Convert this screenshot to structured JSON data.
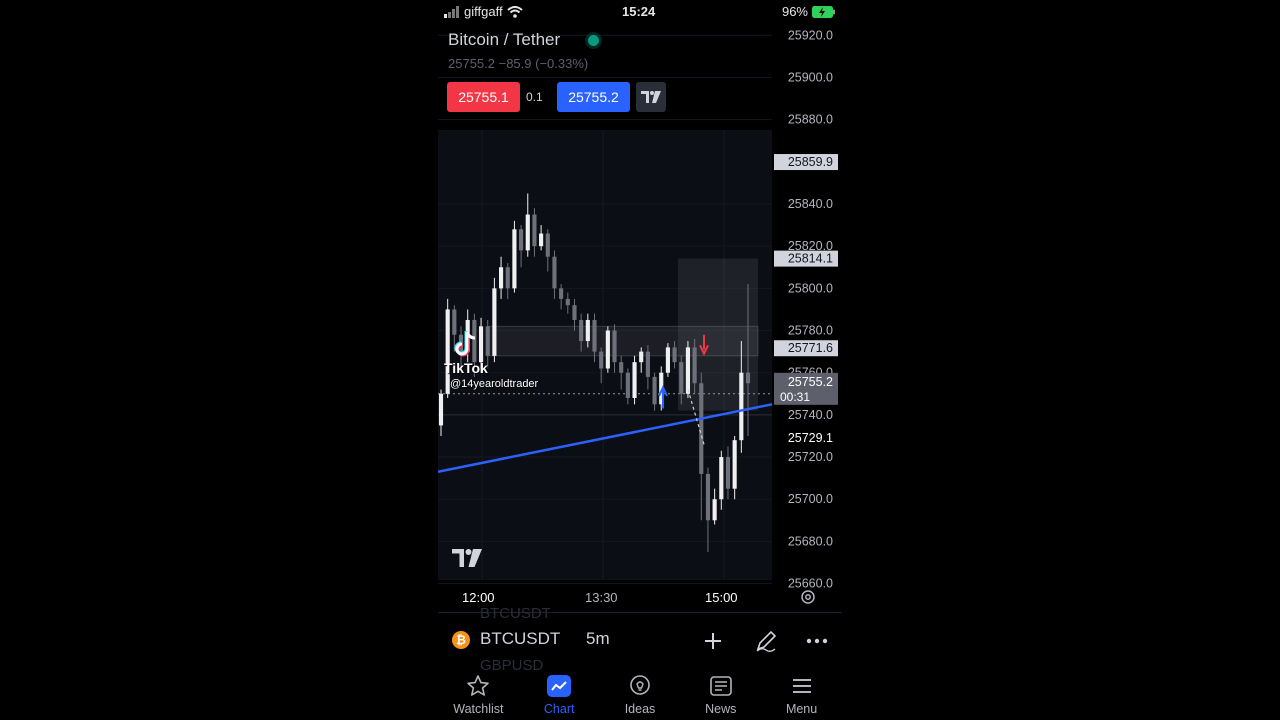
{
  "status_bar": {
    "carrier": "giffgaff",
    "time": "15:24",
    "battery": "96%"
  },
  "header": {
    "title": "Bitcoin / Tether",
    "quote": "25755.2 −85.9 (−0.33%)",
    "sell_price": "25755.1",
    "spread": "0.1",
    "buy_price": "25755.2"
  },
  "chart_data": {
    "type": "candlestick",
    "y_ticks": [
      "25920.0",
      "25900.0",
      "25880.0",
      "25840.0",
      "25820.0",
      "25800.0",
      "25780.0",
      "25760.0",
      "25740.0",
      "25720.0",
      "25700.0",
      "25680.0",
      "25660.0"
    ],
    "y_tick_values": [
      25920,
      25900,
      25880,
      25840,
      25820,
      25800,
      25780,
      25760,
      25740,
      25720,
      25700,
      25680,
      25660
    ],
    "ylim": [
      25656,
      25932
    ],
    "x_ticks": [
      "12:00",
      "13:30",
      "15:00"
    ],
    "price_tags": [
      {
        "value": 25859.9,
        "label": "25859.9"
      },
      {
        "value": 25814.1,
        "label": "25814.1"
      },
      {
        "value": 25771.6,
        "label": "25771.6"
      },
      {
        "value": 25729.1,
        "label": "25729.1"
      }
    ],
    "last_price": {
      "value": 25755.2,
      "label": "25755.2",
      "countdown": "00:31"
    },
    "candles": [
      [
        25735,
        25750,
        25730,
        25752
      ],
      [
        25750,
        25790,
        25748,
        25795
      ],
      [
        25790,
        25778,
        25770,
        25792
      ],
      [
        25778,
        25770,
        25762,
        25782
      ],
      [
        25770,
        25785,
        25765,
        25790
      ],
      [
        25785,
        25765,
        25758,
        25788
      ],
      [
        25765,
        25782,
        25760,
        25786
      ],
      [
        25782,
        25768,
        25762,
        25785
      ],
      [
        25768,
        25800,
        25765,
        25805
      ],
      [
        25800,
        25810,
        25795,
        25815
      ],
      [
        25810,
        25800,
        25795,
        25812
      ],
      [
        25800,
        25828,
        25798,
        25832
      ],
      [
        25828,
        25818,
        25810,
        25830
      ],
      [
        25818,
        25835,
        25815,
        25845
      ],
      [
        25835,
        25820,
        25815,
        25838
      ],
      [
        25820,
        25826,
        25818,
        25830
      ],
      [
        25826,
        25815,
        25808,
        25828
      ],
      [
        25815,
        25800,
        25795,
        25818
      ],
      [
        25800,
        25795,
        25790,
        25802
      ],
      [
        25795,
        25792,
        25788,
        25798
      ],
      [
        25792,
        25785,
        25780,
        25795
      ],
      [
        25785,
        25775,
        25770,
        25788
      ],
      [
        25775,
        25785,
        25772,
        25788
      ],
      [
        25785,
        25770,
        25765,
        25788
      ],
      [
        25770,
        25762,
        25755,
        25772
      ],
      [
        25762,
        25780,
        25760,
        25782
      ],
      [
        25780,
        25765,
        25760,
        25783
      ],
      [
        25765,
        25760,
        25752,
        25768
      ],
      [
        25760,
        25748,
        25745,
        25762
      ],
      [
        25748,
        25765,
        25745,
        25768
      ],
      [
        25765,
        25770,
        25760,
        25772
      ],
      [
        25770,
        25758,
        25752,
        25773
      ],
      [
        25758,
        25745,
        25742,
        25760
      ],
      [
        25745,
        25760,
        25742,
        25763
      ],
      [
        25760,
        25772,
        25758,
        25774
      ],
      [
        25772,
        25765,
        25762,
        25775
      ],
      [
        25765,
        25750,
        25745,
        25768
      ],
      [
        25750,
        25772,
        25748,
        25775
      ],
      [
        25772,
        25755,
        25750,
        25776
      ],
      [
        25755,
        25712,
        25690,
        25760
      ],
      [
        25712,
        25690,
        25675,
        25715
      ],
      [
        25690,
        25700,
        25688,
        25705
      ],
      [
        25700,
        25720,
        25695,
        25723
      ],
      [
        25720,
        25705,
        25700,
        25725
      ],
      [
        25705,
        25728,
        25700,
        25730
      ],
      [
        25728,
        25760,
        25722,
        25775
      ],
      [
        25760,
        25755,
        25730,
        25802
      ]
    ],
    "trendline": {
      "from": [
        0,
        25713
      ],
      "to": [
        1,
        25745
      ]
    }
  },
  "overlay": {
    "tiktok_name": "TikTok",
    "tiktok_user": "@14yearoldtrader"
  },
  "symbol_bar": {
    "symbol": "BTCUSDT",
    "timeframe": "5m",
    "ghost_above": "BTCUSDT",
    "ghost_below": "GBPUSD"
  },
  "nav": {
    "items": [
      {
        "label": "Watchlist"
      },
      {
        "label": "Chart"
      },
      {
        "label": "Ideas"
      },
      {
        "label": "News"
      },
      {
        "label": "Menu"
      }
    ]
  },
  "colors": {
    "sell": "#f23645",
    "buy": "#2962ff",
    "trendline": "#2962ff",
    "live": "#089981"
  }
}
